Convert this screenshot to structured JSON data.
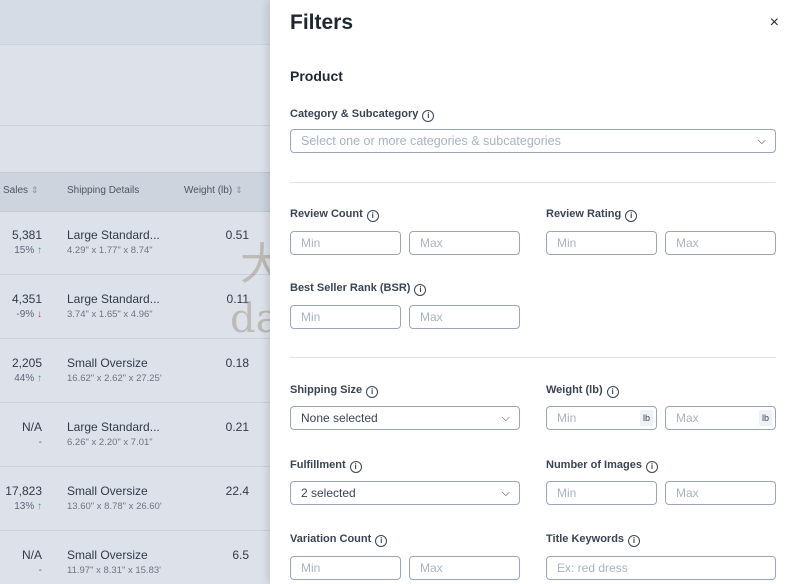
{
  "table": {
    "headers": {
      "sales": "Sales",
      "shipping": "Shipping Details",
      "weight": "Weight (lb)"
    },
    "rows": [
      {
        "sales": "5,381",
        "change": "15%",
        "dir": "up",
        "ship": "Large Standard...",
        "dims": "4.29\" x 1.77\" x 8.74\"",
        "weight": "0.51"
      },
      {
        "sales": "4,351",
        "change": "-9%",
        "dir": "down",
        "ship": "Large Standard...",
        "dims": "3.74\" x 1.65\" x 4.96\"",
        "weight": "0.11"
      },
      {
        "sales": "2,205",
        "change": "44%",
        "dir": "up",
        "ship": "Small Oversize",
        "dims": "16.62\" x 2.62\" x 27.25'",
        "weight": "0.18"
      },
      {
        "sales": "N/A",
        "change": "-",
        "dir": "none",
        "ship": "Large Standard...",
        "dims": "6.26\" x 2.20\" x 7.01\"",
        "weight": "0.21"
      },
      {
        "sales": "17,823",
        "change": "13%",
        "dir": "up",
        "ship": "Small Oversize",
        "dims": "13.60\" x 8.78\" x 26.60'",
        "weight": "22.4"
      },
      {
        "sales": "N/A",
        "change": "-",
        "dir": "none",
        "ship": "Small Oversize",
        "dims": "11.97\" x 8.31\" x 15.83'",
        "weight": "6.5"
      }
    ]
  },
  "filters": {
    "title": "Filters",
    "close": "×",
    "section": "Product",
    "category": {
      "label": "Category & Subcategory",
      "placeholder": "Select one or more categories & subcategories"
    },
    "review_count": {
      "label": "Review Count",
      "min": "Min",
      "max": "Max"
    },
    "review_rating": {
      "label": "Review Rating",
      "min": "Min",
      "max": "Max"
    },
    "bsr": {
      "label": "Best Seller Rank (BSR)",
      "min": "Min",
      "max": "Max"
    },
    "shipping_size": {
      "label": "Shipping Size",
      "value": "None selected"
    },
    "weight": {
      "label": "Weight (lb)",
      "min": "Min",
      "max": "Max",
      "unit": "lb"
    },
    "fulfillment": {
      "label": "Fulfillment",
      "value": "2 selected"
    },
    "images": {
      "label": "Number of Images",
      "min": "Min",
      "max": "Max"
    },
    "variation": {
      "label": "Variation Count",
      "min": "Min",
      "max": "Max"
    },
    "keywords": {
      "label": "Title Keywords",
      "placeholder": "Ex: red dress"
    }
  },
  "watermark": {
    "line1": "大海笔记",
    "line2": "dahaibiji.com"
  },
  "icons": {
    "info": "info-icon",
    "chevron": "chevron-down-icon",
    "up": "arrow-up-icon",
    "down": "arrow-down-icon",
    "close": "close-icon"
  },
  "colors": {
    "up": "#2fa679",
    "down": "#d5453b",
    "border": "#9aa6b8"
  }
}
